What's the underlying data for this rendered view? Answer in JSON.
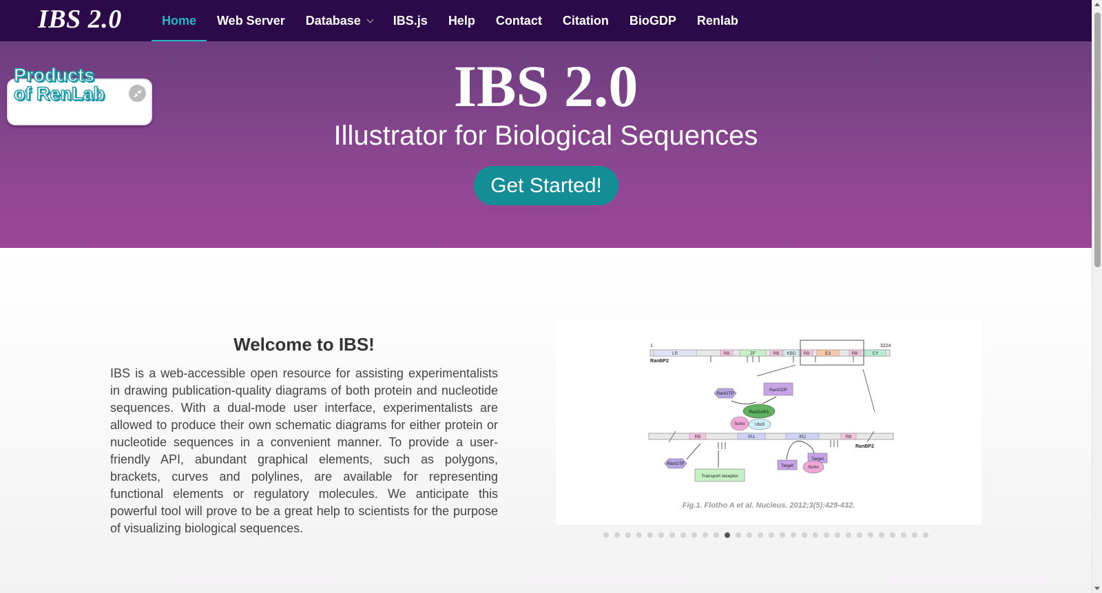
{
  "brand": "IBS 2.0",
  "nav": [
    {
      "label": "Home",
      "active": true
    },
    {
      "label": "Web Server"
    },
    {
      "label": "Database",
      "dropdown": true
    },
    {
      "label": "IBS.js"
    },
    {
      "label": "Help"
    },
    {
      "label": "Contact"
    },
    {
      "label": "Citation"
    },
    {
      "label": "BioGDP"
    },
    {
      "label": "Renlab"
    }
  ],
  "hero": {
    "title": "IBS 2.0",
    "subtitle": "Illustrator for Biological Sequences",
    "cta": "Get Started!"
  },
  "products": {
    "line1": "Products",
    "line2": "of RenLab",
    "toggle_icon": "collapse-icon"
  },
  "welcome": {
    "title": "Welcome to IBS!",
    "text": "IBS is a web-accessible open resource for assisting experimentalists in drawing publication-quality diagrams of both protein and nucleotide sequences. With a dual-mode user interface, experimentalists are allowed to produce their own schematic diagrams for either protein or nucleotide sequences in a convenient manner. To provide a user-friendly API, abundant graphical elements, such as polygons, brackets, curves and polylines, are available for representing functional elements or regulatory molecules. We anticipate this powerful tool will prove to be a great help to scientists for the purpose of visualizing biological sequences."
  },
  "figure": {
    "caption": "Fig.1. Flotho A et al. Nucleus. 2012;3(5):429-432.",
    "top_protein": "RanBP2",
    "top_start": "1",
    "top_end": "3224",
    "top_domains": [
      "LR",
      "RB",
      "ZF",
      "RB",
      "KBD",
      "RB",
      "E3",
      "RB",
      "CY"
    ],
    "molecules": [
      "RanGTP",
      "RanGDP",
      "RanGAP1",
      "Sumo",
      "Ubc9"
    ],
    "bottom_protein": "RanBP2",
    "bottom_domains": [
      "RB",
      "IR1",
      "IR2",
      "RB"
    ],
    "bottom_molecules": [
      "RanGTP",
      "Transport receptor",
      "Target",
      "Target",
      "Sumo"
    ]
  },
  "carousel": {
    "count": 30,
    "active_index": 11
  },
  "colors": {
    "nav_bg": "#2c0a4a",
    "accent": "#25b6c4",
    "cta": "#138e97"
  }
}
